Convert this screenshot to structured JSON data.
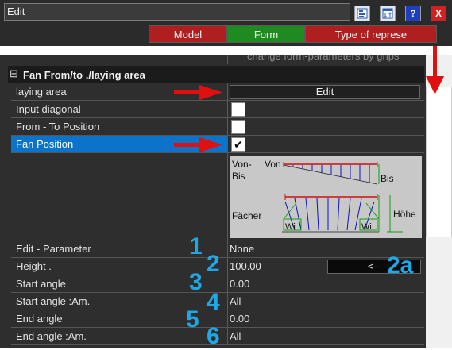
{
  "window": {
    "title": "Edit",
    "icons": {
      "tree": "tree-view-icon",
      "sort": "sort-icon",
      "help": "help-icon",
      "close": "close-icon"
    },
    "help_glyph": "?",
    "close_glyph": "X"
  },
  "tabs": [
    {
      "label": "Model",
      "color": "#b01f1f"
    },
    {
      "label": "Form",
      "color": "#1f8a1f"
    },
    {
      "label": "Type of represe",
      "color": "#b01f1f"
    }
  ],
  "hint": "change form-parameters by grips",
  "section": {
    "title": "Fan From/to ./laying area",
    "collapse_glyph": "⊟"
  },
  "rows": {
    "laying_area": {
      "label": "laying area",
      "button": "Edit"
    },
    "input_diagonal": {
      "label": "Input diagonal",
      "checked": false
    },
    "from_to": {
      "label": "From - To  Position",
      "checked": false
    },
    "fan_position": {
      "label": "Fan Position",
      "checked": true,
      "check_glyph": "✔"
    }
  },
  "diagram": {
    "von_bis": "Von-\nBis",
    "von": "Von",
    "bis": "Bis",
    "facher": "Fächer",
    "hohe": "Höhe",
    "wi_left": "Wi",
    "wi_right": "Wi"
  },
  "params": [
    {
      "label": "Edit - Parameter",
      "value": "None",
      "marker": "1"
    },
    {
      "label": "Height .",
      "value": "100.00",
      "marker": "2",
      "button": "<--",
      "button_marker": "2a"
    },
    {
      "label": "Start angle",
      "value": "0.00",
      "marker": "3"
    },
    {
      "label": "Start angle  :Am.",
      "value": "All",
      "marker": "4"
    },
    {
      "label": "End angle",
      "value": "0.00",
      "marker": "5"
    },
    {
      "label": "End angle   :Am.",
      "value": "All",
      "marker": "6"
    }
  ],
  "colors": {
    "selected_row": "#0b73c9",
    "arrow": "#e01010",
    "marker": "#1fa7e6"
  }
}
